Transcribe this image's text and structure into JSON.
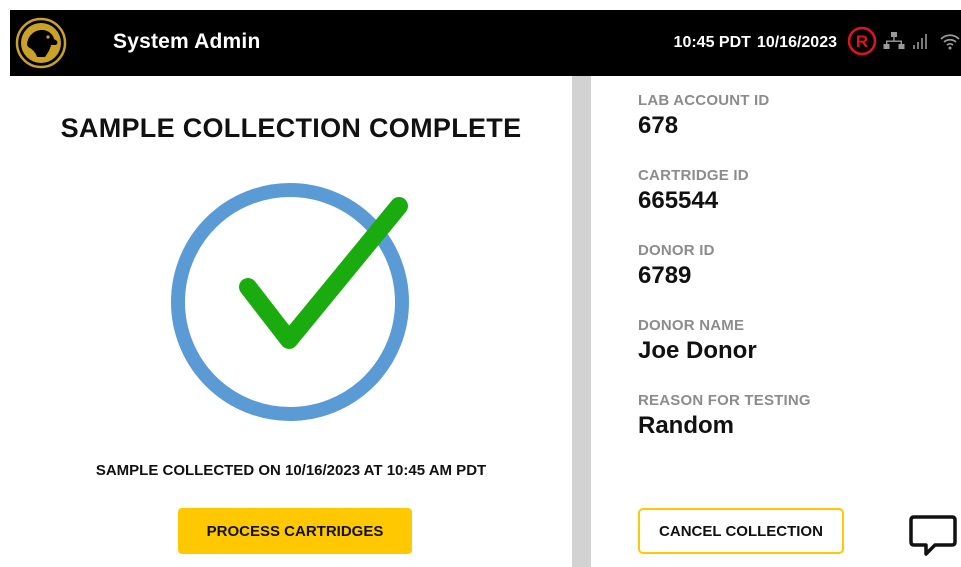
{
  "header": {
    "title": "System Admin",
    "time": "10:45 PDT",
    "date": "10/16/2023",
    "status_icons": [
      "registered-icon",
      "network-icon",
      "signal-icon",
      "wifi-icon"
    ],
    "accent_red": "#e0141e"
  },
  "main": {
    "title": "SAMPLE COLLECTION COMPLETE",
    "collected_text": "SAMPLE COLLECTED ON 10/16/2023 AT 10:45 AM PDT",
    "process_button_label": "PROCESS CARTRIDGES",
    "ring_color": "#5b9bd5",
    "check_color": "#1aab0e"
  },
  "details": {
    "fields": [
      {
        "label": "LAB ACCOUNT ID",
        "value": "678"
      },
      {
        "label": "CARTRIDGE ID",
        "value": "665544"
      },
      {
        "label": "DONOR ID",
        "value": "6789"
      },
      {
        "label": "DONOR NAME",
        "value": "Joe Donor"
      },
      {
        "label": "REASON FOR TESTING",
        "value": "Random"
      }
    ],
    "cancel_button_label": "CANCEL COLLECTION"
  },
  "colors": {
    "button_yellow": "#ffc800",
    "header_bg": "#000000",
    "divider": "#d2d2d2",
    "label_gray": "#8c8c8c"
  }
}
